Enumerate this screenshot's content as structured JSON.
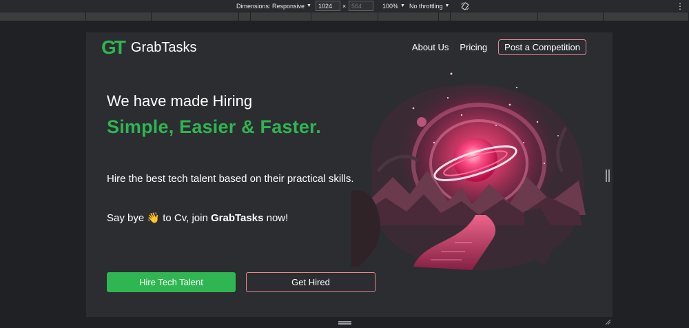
{
  "devtools": {
    "dimensions_label": "Dimensions: Responsive",
    "width_value": "1024",
    "times": "×",
    "height_placeholder": "564",
    "zoom": "100%",
    "throttling": "No throttling",
    "rotate_icon": "rotate-icon",
    "menu_icon": "more-vert-icon",
    "menu_glyph": "⋮"
  },
  "nav": {
    "logo_mark": "GT",
    "brand": "GrabTasks",
    "links": [
      "About Us",
      "Pricing"
    ],
    "cta": "Post a Competition"
  },
  "hero": {
    "line1": "We have made Hiring",
    "line2": "Simple, Easier & Faster.",
    "description": "Hire the best tech talent based on their practical skills.",
    "bye_prefix": "Say bye",
    "bye_emoji": "👋",
    "bye_middle": "to Cv, join",
    "bye_brand": "GrabTasks",
    "bye_suffix": "now!",
    "primary_button": "Hire Tech Talent",
    "secondary_button": "Get Hired"
  },
  "colors": {
    "accent_green": "#2fb552",
    "accent_pink": "#e5888c",
    "page_bg": "#2b2d31"
  }
}
